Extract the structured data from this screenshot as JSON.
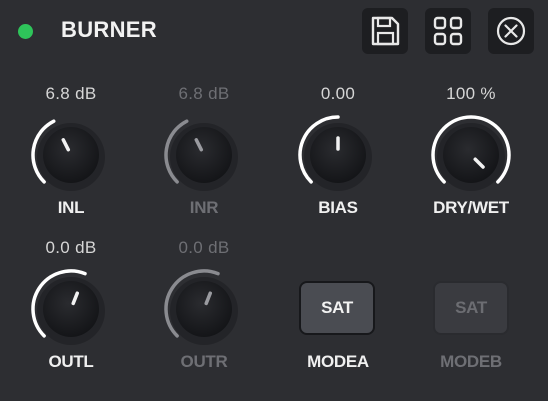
{
  "header": {
    "title": "BURNER",
    "status_color": "#2ec45a",
    "buttons": [
      {
        "name": "save",
        "icon": "floppy-disk-icon"
      },
      {
        "name": "presets",
        "icon": "grid-icon"
      },
      {
        "name": "close",
        "icon": "close-circle-icon"
      }
    ]
  },
  "knobs": [
    {
      "id": "inl",
      "label": "INL",
      "value": "6.8 dB",
      "level": 0.4,
      "enabled": true
    },
    {
      "id": "inr",
      "label": "INR",
      "value": "6.8 dB",
      "level": 0.4,
      "enabled": false
    },
    {
      "id": "bias",
      "label": "BIAS",
      "value": "0.00",
      "level": 0.5,
      "enabled": true
    },
    {
      "id": "drywet",
      "label": "DRY/WET",
      "value": "100 %",
      "level": 1.0,
      "enabled": true
    },
    {
      "id": "outl",
      "label": "OUTL",
      "value": "0.0 dB",
      "level": 0.58,
      "enabled": true
    },
    {
      "id": "outr",
      "label": "OUTR",
      "value": "0.0 dB",
      "level": 0.58,
      "enabled": false
    }
  ],
  "modes": [
    {
      "id": "modea",
      "label": "MODEA",
      "button": "SAT",
      "enabled": true
    },
    {
      "id": "modeb",
      "label": "MODEB",
      "button": "SAT",
      "enabled": false
    }
  ],
  "colors": {
    "background": "#2d2e32",
    "knob": "#1a1b1e",
    "arc_active": "#ffffff",
    "arc_dim": "#8a8b90"
  }
}
